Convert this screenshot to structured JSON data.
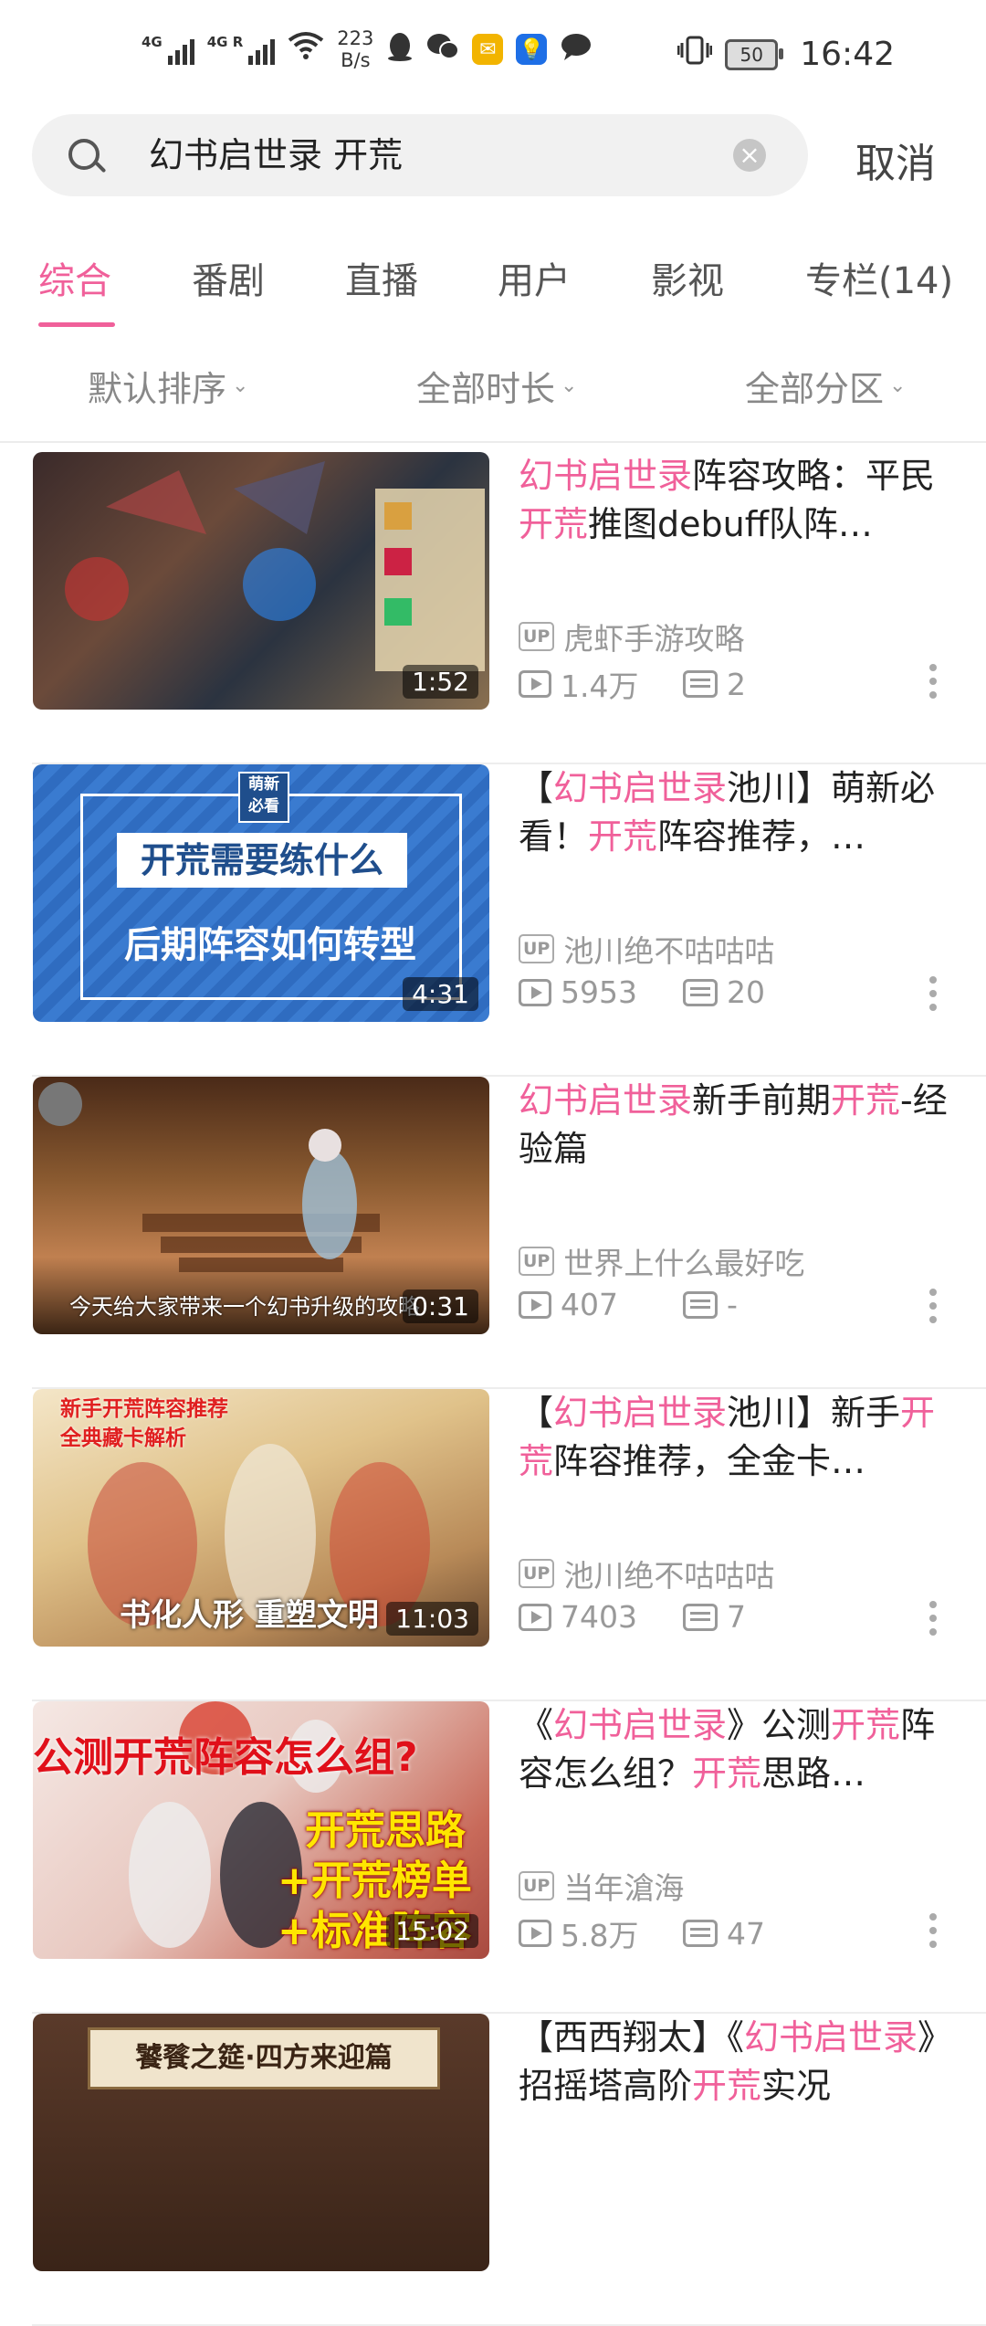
{
  "status_bar": {
    "net1": "4G",
    "net2": "4G R",
    "speed_value": "223",
    "speed_unit": "B/s",
    "battery": "50",
    "time": "16:42"
  },
  "search": {
    "query": "幻书启世录 开荒",
    "cancel": "取消"
  },
  "tabs": [
    "综合",
    "番剧",
    "直播",
    "用户",
    "影视",
    "专栏(14)"
  ],
  "filters": [
    "默认排序",
    "全部时长",
    "全部分区"
  ],
  "videos": [
    {
      "title": [
        {
          "t": "幻书启世录",
          "hl": true
        },
        {
          "t": "阵容攻略：平民",
          "hl": false
        },
        {
          "t": "开荒",
          "hl": true
        },
        {
          "t": "推图debuff队阵…",
          "hl": false
        }
      ],
      "duration": "1:52",
      "uploader": "虎虾手游攻略",
      "views": "1.4万",
      "danmaku": "2",
      "thumb_text": []
    },
    {
      "title": [
        {
          "t": "【",
          "hl": false
        },
        {
          "t": "幻书启世录",
          "hl": true
        },
        {
          "t": "池川】萌新必看！",
          "hl": false
        },
        {
          "t": "开荒",
          "hl": true
        },
        {
          "t": "阵容推荐，…",
          "hl": false
        }
      ],
      "duration": "4:31",
      "uploader": "池川绝不咕咕咕",
      "views": "5953",
      "danmaku": "20",
      "thumb_text": [
        "萌新",
        "必看",
        "开荒需要练什么",
        "后期阵容如何转型"
      ]
    },
    {
      "title": [
        {
          "t": "幻书启世录",
          "hl": true
        },
        {
          "t": "新手前期",
          "hl": false
        },
        {
          "t": "开荒",
          "hl": true
        },
        {
          "t": "-经验篇",
          "hl": false
        }
      ],
      "duration": "0:31",
      "uploader": "世界上什么最好吃",
      "views": "407",
      "danmaku": "-",
      "thumb_text": [
        "今天给大家带来一个幻书升级的攻略"
      ]
    },
    {
      "title": [
        {
          "t": "【",
          "hl": false
        },
        {
          "t": "幻书启世录",
          "hl": true
        },
        {
          "t": "池川】新手",
          "hl": false
        },
        {
          "t": "开荒",
          "hl": true
        },
        {
          "t": "阵容推荐，全金卡…",
          "hl": false
        }
      ],
      "duration": "11:03",
      "uploader": "池川绝不咕咕咕",
      "views": "7403",
      "danmaku": "7",
      "thumb_text": [
        "新手开荒阵容推荐",
        "全典藏卡解析",
        "书化人形 重塑文明"
      ]
    },
    {
      "title": [
        {
          "t": "《",
          "hl": false
        },
        {
          "t": "幻书启世录",
          "hl": true
        },
        {
          "t": "》公测",
          "hl": false
        },
        {
          "t": "开荒",
          "hl": true
        },
        {
          "t": "阵容怎么组？",
          "hl": false
        },
        {
          "t": "开荒",
          "hl": true
        },
        {
          "t": "思路…",
          "hl": false
        }
      ],
      "duration": "15:02",
      "uploader": "当年滄海",
      "views": "5.8万",
      "danmaku": "47",
      "thumb_text": [
        "公测开荒阵容怎么组?",
        "开荒思路",
        "+开荒榜单",
        "+标准阵容"
      ]
    },
    {
      "title": [
        {
          "t": "【西西翔太】《",
          "hl": false
        },
        {
          "t": "幻书启世录",
          "hl": true
        },
        {
          "t": "》招摇塔高阶",
          "hl": false
        },
        {
          "t": "开荒",
          "hl": true
        },
        {
          "t": "实况",
          "hl": false
        }
      ],
      "duration": "",
      "uploader": "",
      "views": "",
      "danmaku": "",
      "thumb_text": [
        "饕餮之筵·四方来迎篇"
      ]
    }
  ],
  "colors": {
    "accent": "#f0609a",
    "text": "#222222",
    "muted": "#999999"
  }
}
